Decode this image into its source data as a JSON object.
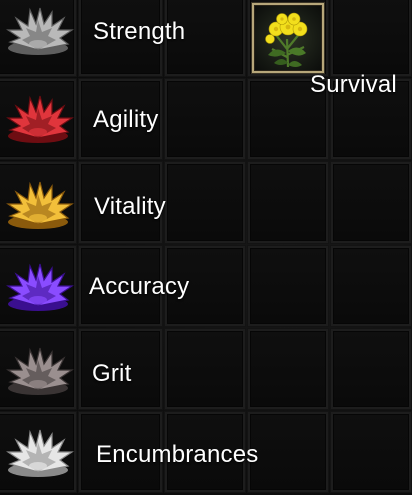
{
  "attributes": [
    {
      "label": "Strength",
      "color": "#9a9a9a",
      "icon": "gray-flower-icon"
    },
    {
      "label": "Agility",
      "color": "#c0222a",
      "icon": "red-flower-icon"
    },
    {
      "label": "Vitality",
      "color": "#d8a020",
      "icon": "gold-flower-icon"
    },
    {
      "label": "Accuracy",
      "color": "#6a2cdc",
      "icon": "purple-flower-icon"
    },
    {
      "label": "Grit",
      "color": "#7a6f6f",
      "icon": "dark-gray-flower-icon"
    },
    {
      "label": "Encumbrances",
      "color": "#c8c8c8",
      "icon": "white-flower-icon"
    }
  ],
  "survival": {
    "label": "Survival",
    "icon": "yellow-flowers-icon",
    "flower_color": "#f2df1c",
    "leaf_color": "#4f7a2a"
  },
  "palette": {
    "background": "#0b0b0b",
    "cell_border": "#1d1d1d",
    "slot_border": "#b7a77a",
    "text": "#ffffff"
  }
}
